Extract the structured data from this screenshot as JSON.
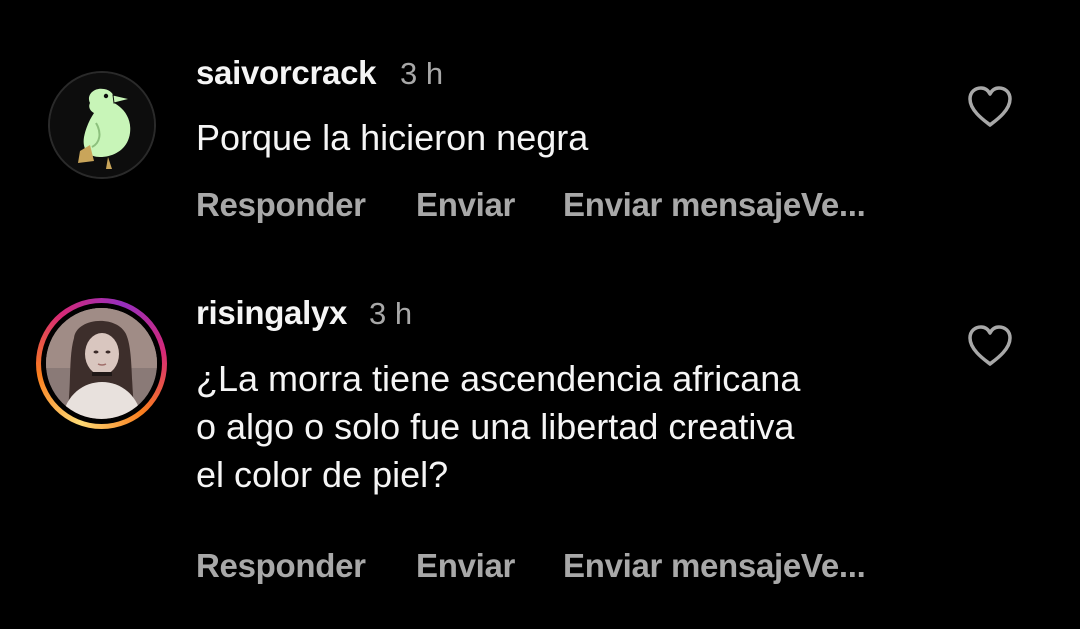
{
  "comments": [
    {
      "username": "saivorcrack",
      "time": "3 h",
      "text": "Porque la hicieron negra",
      "actions": {
        "reply": "Responder",
        "send": "Enviar",
        "message": "Enviar mensajeVe..."
      }
    },
    {
      "username": "risingalyx",
      "time": "3 h",
      "text": "¿La morra tiene ascendencia africana\no algo o solo fue una libertad creativa\nel color de piel?",
      "actions": {
        "reply": "Responder",
        "send": "Enviar",
        "message": "Enviar mensajeVe..."
      }
    }
  ],
  "colors": {
    "background": "#000000",
    "primary_text": "#f5f5f5",
    "secondary_text": "#a8a8a8",
    "avatar_bird": "#c8f5b8"
  },
  "icons": {
    "like": "heart-outline-icon"
  }
}
